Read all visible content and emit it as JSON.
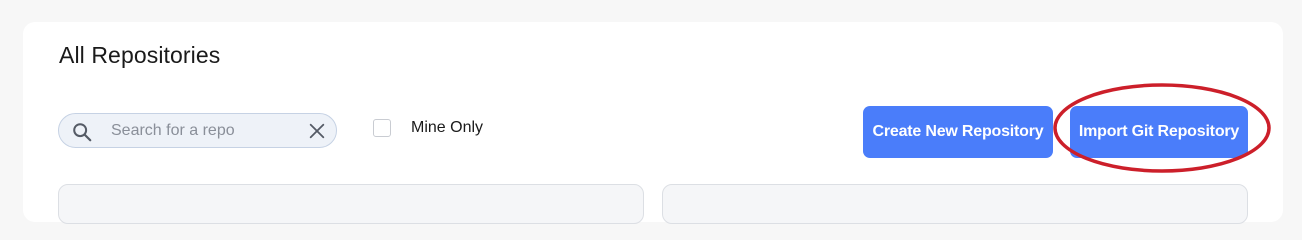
{
  "header": {
    "title": "All Repositories"
  },
  "filters": {
    "search_placeholder": "Search for a repo",
    "search_value": "",
    "mine_only_label": "Mine Only",
    "mine_only_checked": false
  },
  "actions": {
    "create_label": "Create New Repository",
    "import_label": "Import Git Repository"
  },
  "colors": {
    "primary_button": "#4a7dfa",
    "highlight_ring": "#cc1f2a"
  },
  "icons": {
    "search": "search-icon",
    "clear": "close-icon",
    "checkbox": "checkbox-icon"
  }
}
